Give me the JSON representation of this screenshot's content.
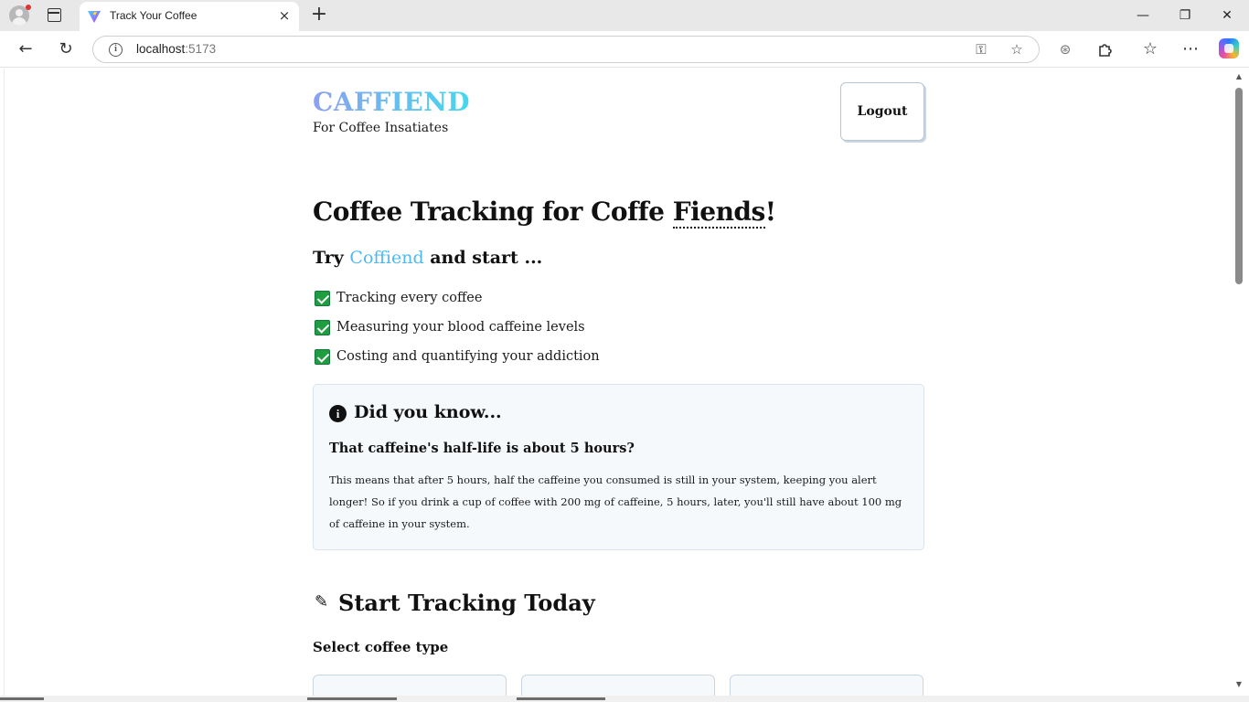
{
  "browser": {
    "tab_title": "Track Your Coffee",
    "tab_close_glyph": "×",
    "new_tab_glyph": "+",
    "window_controls": {
      "minimize": "—",
      "restore": "❐",
      "close": "✕"
    },
    "url_host": "localhost",
    "url_port": ":5173",
    "nav": {
      "back": "←",
      "reload": "↻"
    },
    "icons": [
      "info-icon",
      "key-icon",
      "star-icon",
      "extension-icon",
      "puzzle-icon",
      "favorites-icon",
      "more-icon",
      "copilot-icon"
    ]
  },
  "header": {
    "brand": "CAFFIEND",
    "tagline": "For Coffee Insatiates",
    "logout_label": "Logout"
  },
  "hero": {
    "title_prefix": "Coffee Tracking for Coffe ",
    "title_fiends": "Fiends",
    "title_suffix": "!",
    "sub_prefix": "Try ",
    "sub_accent": "Coffiend",
    "sub_suffix": " and start ..."
  },
  "features": [
    "Tracking every coffee",
    "Measuring your blood caffeine levels",
    "Costing and quantifying your addiction"
  ],
  "did_you_know": {
    "title": "Did you know...",
    "question": "That caffeine's half-life is about 5 hours?",
    "body": "This means that after 5 hours, half the caffeine you consumed is still in your system, keeping you alert longer! So if you drink a cup of coffee with 200 mg of caffeine, 5 hours, later, you'll still have about 100 mg of caffeine in your system."
  },
  "tracking": {
    "title": "Start Tracking Today",
    "select_label": "Select coffee type"
  },
  "colors": {
    "brand_gradient_start": "#8da0f0",
    "brand_gradient_end": "#43d8ee",
    "accent": "#4fb9ef",
    "check_green": "#1f9d3f",
    "card_bg": "#f6f9fc",
    "card_border": "#dbe3ec"
  }
}
